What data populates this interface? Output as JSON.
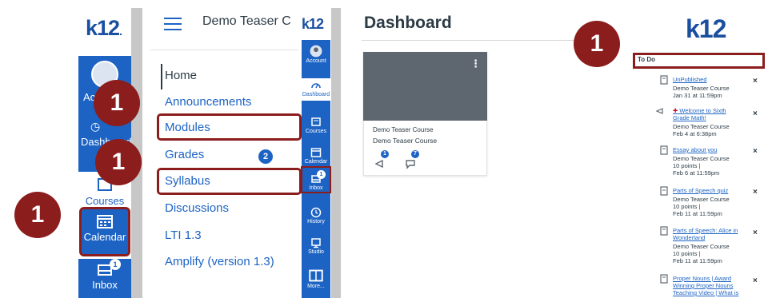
{
  "brand": {
    "logo_text": "k12",
    "logo_dot": "."
  },
  "global_nav_wide": {
    "account_label": "Account",
    "dashboard_label": "Dashboard",
    "courses_label": "Courses",
    "calendar_label": "Calendar",
    "inbox_label": "Inbox",
    "inbox_badge": "1"
  },
  "course_nav": {
    "course_title": "Demo Teaser C",
    "items": [
      {
        "label": "Home"
      },
      {
        "label": "Announcements"
      },
      {
        "label": "Modules"
      },
      {
        "label": "Grades",
        "badge": "2"
      },
      {
        "label": "Syllabus"
      },
      {
        "label": "Discussions"
      },
      {
        "label": "LTI 1.3"
      },
      {
        "label": "Amplify (version 1.3)"
      }
    ]
  },
  "global_nav_narrow": {
    "items": [
      {
        "label": "Account"
      },
      {
        "label": "Dashboard"
      },
      {
        "label": "Courses"
      },
      {
        "label": "Calendar"
      },
      {
        "label": "Inbox",
        "badge": "1"
      },
      {
        "label": "History"
      },
      {
        "label": "Studio"
      },
      {
        "label": "More..."
      }
    ]
  },
  "dashboard": {
    "title": "Dashboard",
    "card": {
      "line1": "Demo Teaser Course",
      "line2": "Demo Teaser Course",
      "announcement_badge": "1",
      "discussion_badge": "7"
    }
  },
  "todo": {
    "heading": "To Do",
    "items": [
      {
        "link": "UnPublished",
        "meta1": "Demo Teaser Course",
        "meta2": "Jan 31 at 11:59pm",
        "meta3": ""
      },
      {
        "link": "Welcome to Sixth",
        "link2": "Grade Math!",
        "meta1": "Demo Teaser Course",
        "meta2": "Feb 4 at 6:38pm",
        "meta3": ""
      },
      {
        "link": "Essay about you",
        "meta1": "Demo Teaser Course",
        "meta2": "10 points |",
        "meta3": "Feb 6 at 11:59pm"
      },
      {
        "link": "Parts of Speech quiz",
        "meta1": "Demo Teaser Course",
        "meta2": "10 points |",
        "meta3": "Feb 11 at 11:59pm"
      },
      {
        "link": "Parts of Speech: Alice in",
        "link2": "Wonderland",
        "meta1": "Demo Teaser Course",
        "meta2": "10 points |",
        "meta3": "Feb 11 at 11:59pm"
      },
      {
        "link": "Proper Nouns | Award",
        "link2": "Winning Proper Nouns",
        "link3": "Teaching Video | What is"
      }
    ],
    "dismiss": "×"
  },
  "callouts": {
    "number": "1"
  },
  "colors": {
    "canvas_blue": "#1c63c4",
    "callout_red": "#8c1d1d",
    "card_gray": "#5e6770",
    "text_dark": "#2d3b45"
  }
}
